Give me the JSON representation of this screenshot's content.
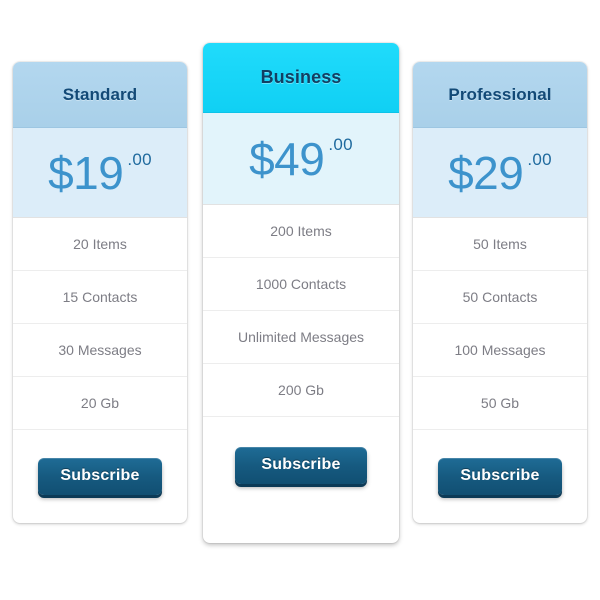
{
  "page": {
    "component": "Pricing Table",
    "background_color": "#ffffff"
  },
  "theme": {
    "header_blue": "#aed4ec",
    "header_cyan": "#1ad4f5",
    "price_bg": "#dcedf9",
    "price_bg_featured": "#e2f4fb",
    "price_color": "#3d93cc",
    "title_color": "#134a77",
    "feature_text_color": "#7d7d85",
    "divider_color": "#ededed",
    "button_color": "#165a80",
    "button_shadow_color": "#0c3a56",
    "button_text_color": "#ffffff"
  },
  "plans": [
    {
      "id": "standard",
      "name": "Standard",
      "featured": false,
      "currency_symbol": "$",
      "price_main": "$19",
      "price_amount": "19",
      "price_cents": ".00",
      "features": [
        "20 Items",
        "15 Contacts",
        "30 Messages",
        "20 Gb"
      ],
      "cta_label": "Subscribe"
    },
    {
      "id": "business",
      "name": "Business",
      "featured": true,
      "currency_symbol": "$",
      "price_main": "$49",
      "price_amount": "49",
      "price_cents": ".00",
      "features": [
        "200 Items",
        "1000 Contacts",
        "Unlimited Messages",
        "200 Gb"
      ],
      "cta_label": "Subscribe"
    },
    {
      "id": "professional",
      "name": "Professional",
      "featured": false,
      "currency_symbol": "$",
      "price_main": "$29",
      "price_amount": "29",
      "price_cents": ".00",
      "features": [
        "50 Items",
        "50 Contacts",
        "100 Messages",
        "50 Gb"
      ],
      "cta_label": "Subscribe"
    }
  ]
}
